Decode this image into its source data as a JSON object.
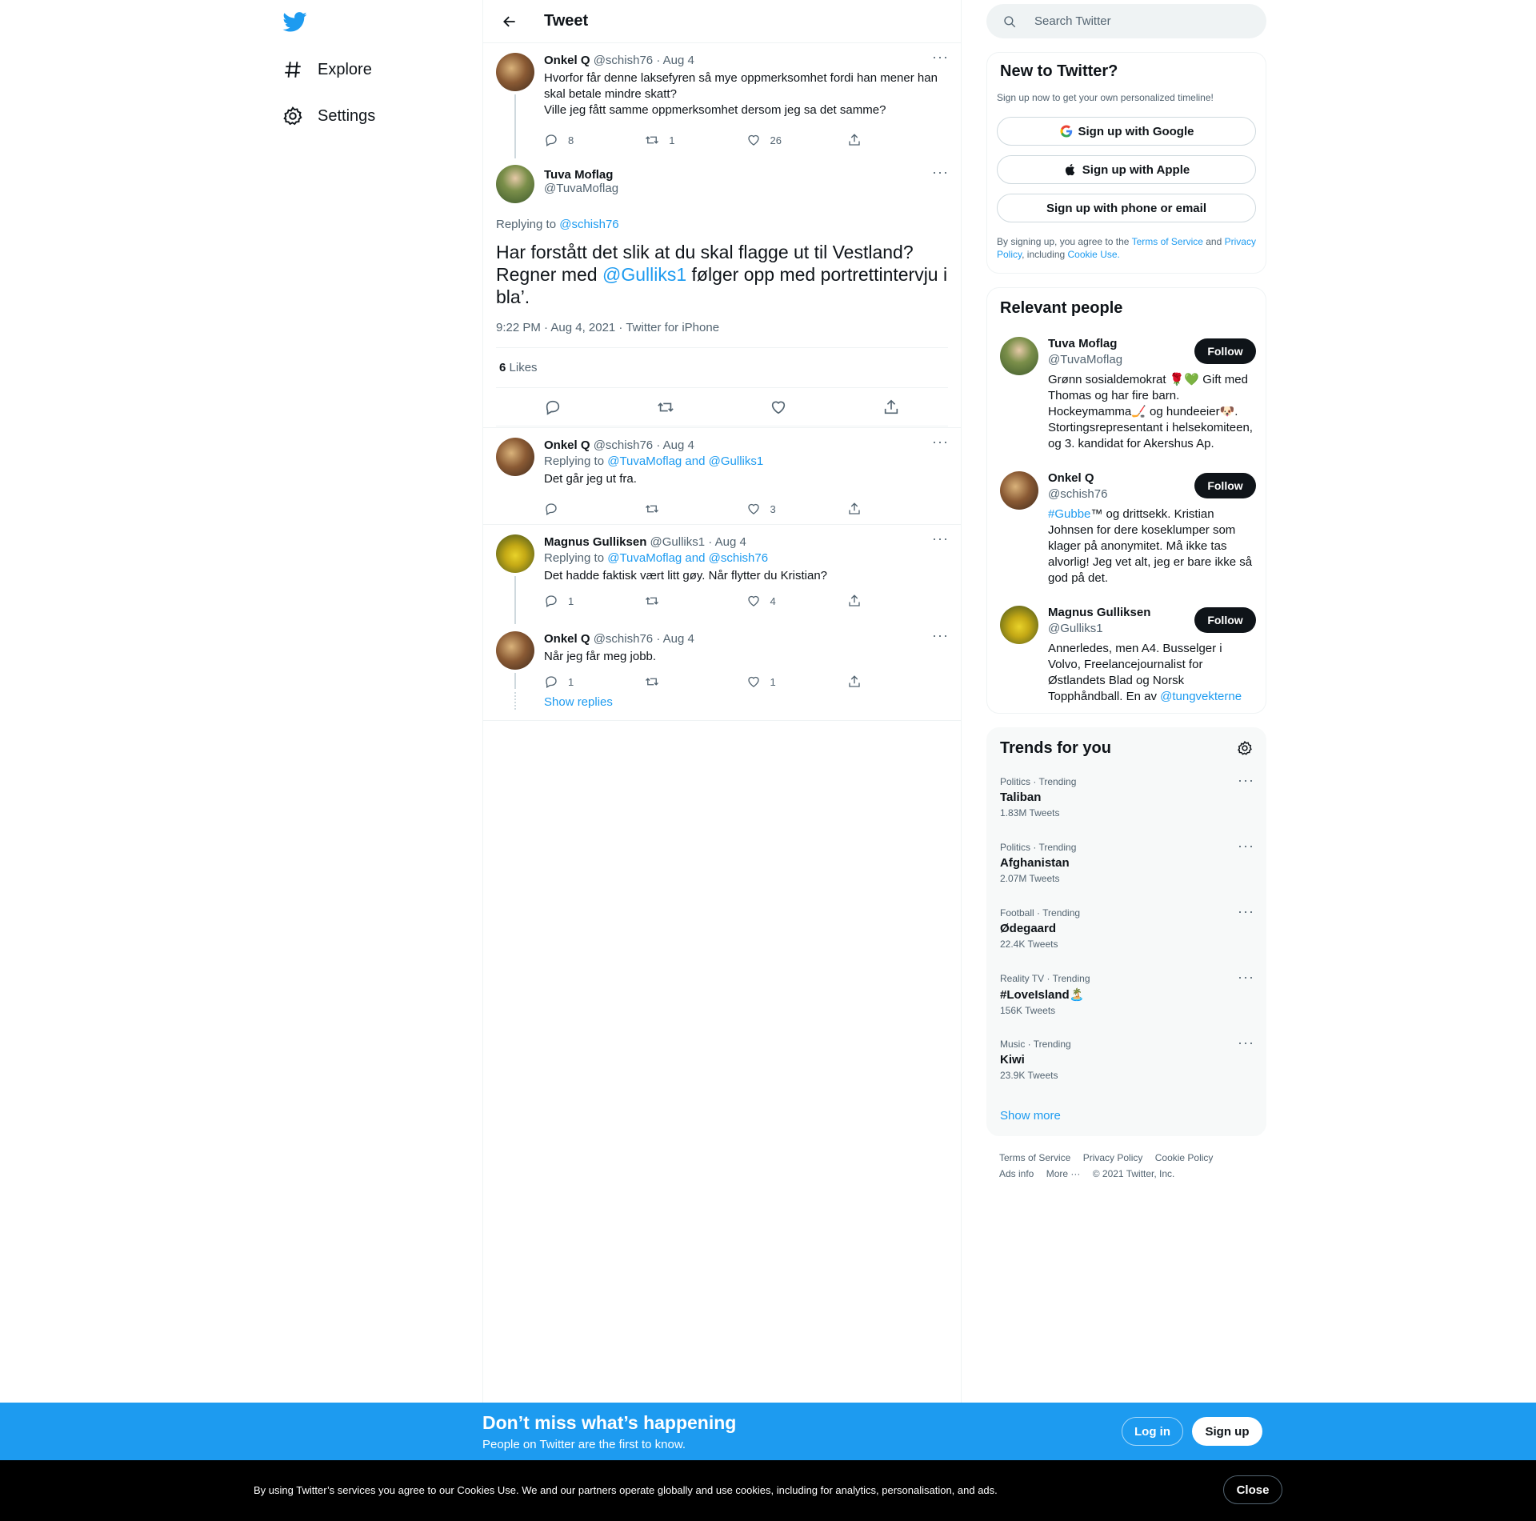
{
  "nav": {
    "explore": "Explore",
    "settings": "Settings"
  },
  "header": {
    "title": "Tweet"
  },
  "parent_tweet": {
    "name": "Onkel Q",
    "handle": "@schish76",
    "date": "· Aug 4",
    "text1": "Hvorfor får denne laksefyren så mye oppmerksomhet fordi han mener han skal betale mindre skatt?",
    "text2": "Ville jeg fått samme oppmerksomhet dersom jeg sa det samme?",
    "replies": "8",
    "retweets": "1",
    "likes": "26"
  },
  "main_tweet": {
    "name": "Tuva Moflag",
    "handle": "@TuvaMoflag",
    "replying_label": "Replying to",
    "replying_to": "@schish76",
    "text_a": "Har forstått det slik at du skal flagge ut til Vestland? Regner med ",
    "mention": "@Gulliks1",
    "text_b": " følger opp med portrettintervju i bla’.",
    "timestamp": "9:22 PM · Aug 4, 2021 · Twitter for iPhone",
    "likes_count": "6",
    "likes_label": "Likes"
  },
  "replies": [
    {
      "name": "Onkel Q",
      "handle": "@schish76",
      "date": "· Aug 4",
      "replying_label": "Replying to",
      "replying_to": "@TuvaMoflag and @Gulliks1",
      "text": "Det går jeg ut fra.",
      "replies": "",
      "retweets": "",
      "likes": "3"
    },
    {
      "name": "Magnus Gulliksen",
      "handle": "@Gulliks1",
      "date": "· Aug 4",
      "replying_label": "Replying to",
      "replying_to": "@TuvaMoflag and @schish76",
      "text": "Det hadde faktisk vært litt gøy. Når flytter du Kristian?",
      "replies": "1",
      "retweets": "",
      "likes": "4"
    },
    {
      "name": "Onkel Q",
      "handle": "@schish76",
      "date": "· Aug 4",
      "text": "Når jeg får meg jobb.",
      "replies": "1",
      "retweets": "",
      "likes": "1"
    }
  ],
  "show_replies": "Show replies",
  "search": {
    "placeholder": "Search Twitter"
  },
  "new_to_twitter": {
    "title": "New to Twitter?",
    "subtitle": "Sign up now to get your own personalized timeline!",
    "google": "Sign up with Google",
    "apple": "Sign up with Apple",
    "phone": "Sign up with phone or email",
    "legal_a": "By signing up, you agree to the ",
    "tos": "Terms of Service",
    "legal_b": " and ",
    "privacy": "Privacy Policy",
    "legal_c": ", including ",
    "cookie": "Cookie Use."
  },
  "relevant_people": {
    "title": "Relevant people",
    "follow_label": "Follow",
    "people": [
      {
        "name": "Tuva Moflag",
        "handle": "@TuvaMoflag",
        "bio": "Grønn sosialdemokrat 🌹💚 Gift med Thomas og har fire barn. Hockeymamma🏒 og hundeeier🐶. Stortingsrepresentant i helsekomiteen, og 3. kandidat for Akershus Ap."
      },
      {
        "name": "Onkel Q",
        "handle": "@schish76",
        "bio_link": "#Gubbe",
        "bio": "™ og drittsekk. Kristian Johnsen for dere koseklumper som klager på anonymitet. Må ikke tas alvorlig! Jeg vet alt, jeg er bare ikke så god på det."
      },
      {
        "name": "Magnus Gulliksen",
        "handle": "@Gulliks1",
        "bio": "Annerledes, men A4. Busselger i Volvo, Freelancejournalist for Østlandets Blad og Norsk Topphåndball. En av ",
        "bio_link": "@tungvekterne"
      }
    ]
  },
  "trends": {
    "title": "Trends for you",
    "show_more": "Show more",
    "items": [
      {
        "meta": "Politics · Trending",
        "name": "Taliban",
        "count": "1.83M Tweets"
      },
      {
        "meta": "Politics · Trending",
        "name": "Afghanistan",
        "count": "2.07M Tweets"
      },
      {
        "meta": "Football · Trending",
        "name": "Ødegaard",
        "count": "22.4K Tweets"
      },
      {
        "meta": "Reality TV · Trending",
        "name": "#LoveIsland🏝️",
        "count": "156K Tweets"
      },
      {
        "meta": "Music · Trending",
        "name": "Kiwi",
        "count": "23.9K Tweets"
      }
    ]
  },
  "footer": {
    "tos": "Terms of Service",
    "privacy": "Privacy Policy",
    "cookie": "Cookie Policy",
    "ads": "Ads info",
    "more": "More ···",
    "copyright": "© 2021 Twitter, Inc."
  },
  "signup_bar": {
    "title": "Don’t miss what’s happening",
    "subtitle": "People on Twitter are the first to know.",
    "login": "Log in",
    "signup": "Sign up"
  },
  "cookie_bar": {
    "text": "By using Twitter’s services you agree to our Cookies Use. We and our partners operate globally and use cookies, including for analytics, personalisation, and ads.",
    "close": "Close"
  }
}
